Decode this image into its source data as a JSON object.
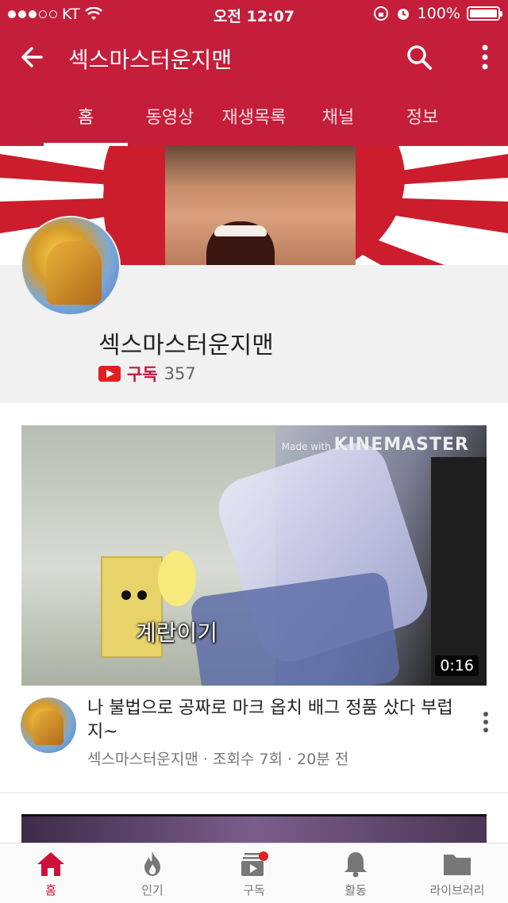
{
  "status_bar": {
    "carrier": "KT",
    "time": "오전 12:07",
    "battery": "100%"
  },
  "header": {
    "title": "섹스마스터운지맨",
    "tabs": [
      "홈",
      "동영상",
      "재생목록",
      "채널",
      "정보"
    ],
    "active_tab": 0
  },
  "channel": {
    "name": "섹스마스터운지맨",
    "subscribe_label": "구독",
    "subscriber_count": "357"
  },
  "video": {
    "overlay_text": "계란이기",
    "watermark": "Made with",
    "watermark_brand": "KINEMASTER",
    "duration": "0:16",
    "title": "나 불법으로 공짜로 마크 옵치 배그 정품 샀다 부럽지~",
    "meta": "섹스마스터운지맨 · 조회수 7회 · 20분 전"
  },
  "bottom_nav": {
    "items": [
      "홈",
      "인기",
      "구독",
      "활동",
      "라이브러리"
    ],
    "active": 0
  },
  "colors": {
    "brand": "#c41e3a",
    "accent": "#d0103a"
  },
  "icons": [
    "back-arrow-icon",
    "search-icon",
    "more-vert-icon",
    "home-icon",
    "fire-icon",
    "subscriptions-icon",
    "bell-icon",
    "folder-icon"
  ]
}
